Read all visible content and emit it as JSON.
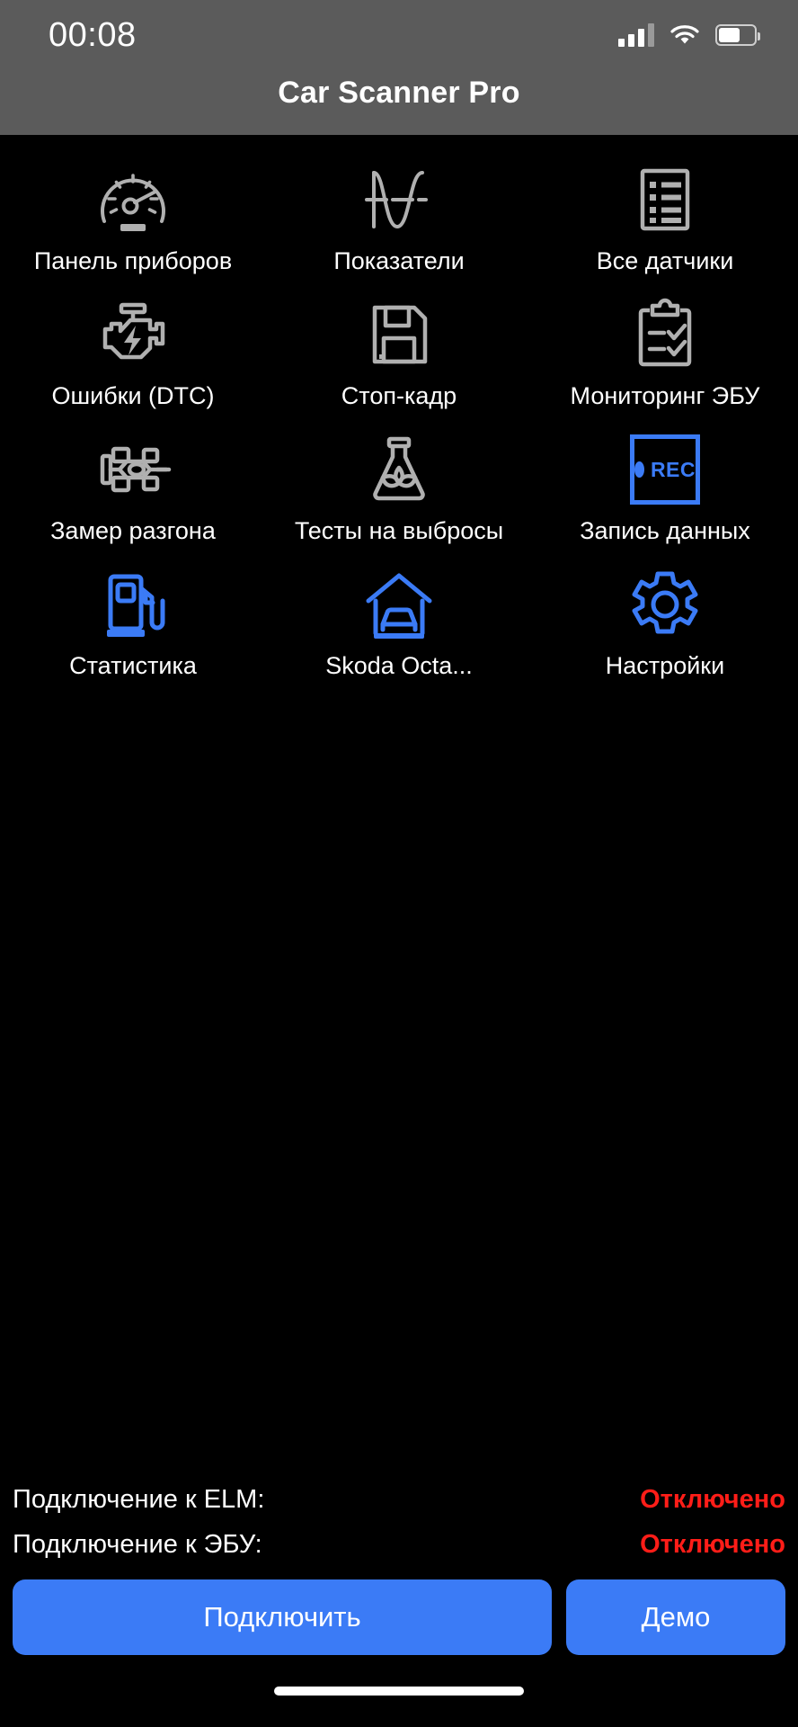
{
  "status_bar": {
    "time": "00:08",
    "signal_icon": "cellular-signal-icon",
    "wifi_icon": "wifi-icon",
    "battery_icon": "battery-icon"
  },
  "header": {
    "title": "Car Scanner Pro"
  },
  "grid": {
    "items": [
      {
        "label": "Панель приборов",
        "icon": "speedometer-icon",
        "color": "#b0b0b0"
      },
      {
        "label": "Показатели",
        "icon": "waveform-icon",
        "color": "#b0b0b0"
      },
      {
        "label": "Все датчики",
        "icon": "list-document-icon",
        "color": "#b0b0b0"
      },
      {
        "label": "Ошибки (DTC)",
        "icon": "check-engine-icon",
        "color": "#b0b0b0"
      },
      {
        "label": "Стоп-кадр",
        "icon": "floppy-disk-icon",
        "color": "#b0b0b0"
      },
      {
        "label": "Мониторинг ЭБУ",
        "icon": "clipboard-check-icon",
        "color": "#b0b0b0"
      },
      {
        "label": "Замер разгона",
        "icon": "race-car-icon",
        "color": "#b0b0b0"
      },
      {
        "label": "Тесты на выбросы",
        "icon": "flask-leaf-icon",
        "color": "#b0b0b0"
      },
      {
        "label": "Запись данных",
        "icon": "rec-box-icon",
        "color": "#3b7bf6",
        "rec_text": "REC"
      },
      {
        "label": "Статистика",
        "icon": "fuel-pump-icon",
        "color": "#3b7bf6"
      },
      {
        "label": "Skoda Octa...",
        "icon": "garage-car-icon",
        "color": "#3b7bf6"
      },
      {
        "label": "Настройки",
        "icon": "gear-icon",
        "color": "#3b7bf6"
      }
    ]
  },
  "connection": {
    "rows": [
      {
        "key": "Подключение к ELM:",
        "value": "Отключено"
      },
      {
        "key": "Подключение к ЭБУ:",
        "value": "Отключено"
      }
    ],
    "status_color": "#ff1d18"
  },
  "actions": {
    "connect_label": "Подключить",
    "demo_label": "Демо",
    "accent_color": "#3b7bf6"
  },
  "home_indicator": "home-indicator-bar"
}
